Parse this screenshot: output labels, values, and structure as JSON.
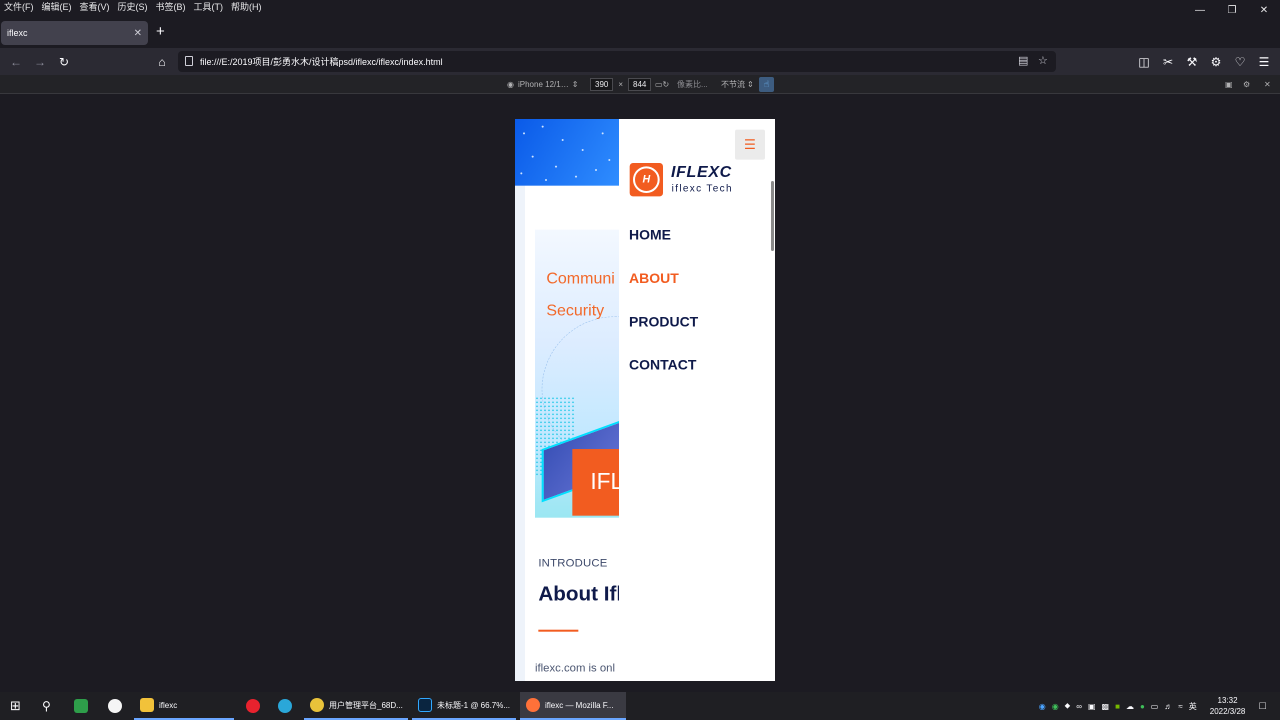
{
  "browser": {
    "menu": [
      "文件(F)",
      "编辑(E)",
      "查看(V)",
      "历史(S)",
      "书签(B)",
      "工具(T)",
      "帮助(H)"
    ],
    "tab_title": "iflexc",
    "url": "file:///E:/2019项目/彭勇水木/设计稿psd/iflexc/iflexc/index.html"
  },
  "rdm": {
    "device": "iPhone 12/1…",
    "width": "390",
    "height": "844",
    "times": "×",
    "dpr": "像素比...",
    "throttle": "不节流"
  },
  "site": {
    "brand": "IFLEXC",
    "brand_sub": "iflexc Tech",
    "nav": [
      {
        "label": "HOME",
        "active": false
      },
      {
        "label": "ABOUT",
        "active": true
      },
      {
        "label": "PRODUCT",
        "active": false
      },
      {
        "label": "CONTACT",
        "active": false
      }
    ],
    "promo_line1": "Communi",
    "promo_line2": "Security",
    "promo_brand": "IFL",
    "intro_label": "INTRODUCE",
    "about_title": "About Ifl",
    "about_text": "iflexc.com is onl",
    "accent_color": "#f25c20",
    "navy_color": "#0f1a4a"
  },
  "taskbar": {
    "items": [
      "iflexc",
      "用户管理平台_68D...",
      "未标题-1 @ 66.7%...",
      "iflexc — Mozilla F..."
    ],
    "lang": "英",
    "time": "13:32",
    "date": "2022/3/28"
  }
}
